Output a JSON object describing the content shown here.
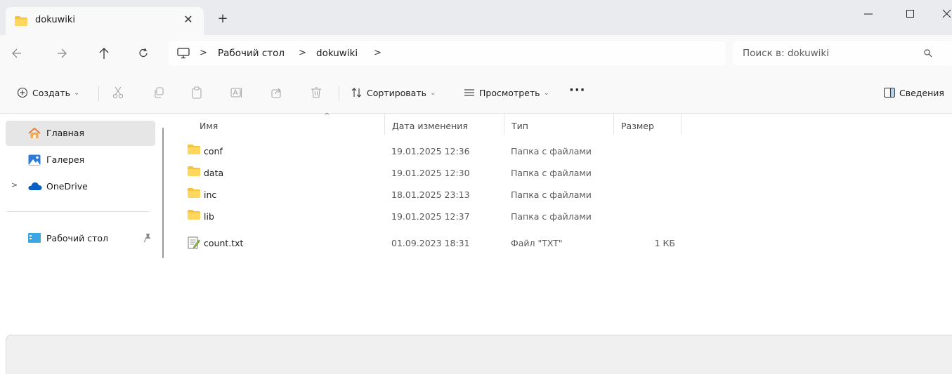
{
  "window": {
    "tab_title": "dokuwiki",
    "close_tab_glyph": "✕",
    "new_tab_glyph": "+",
    "minimize_glyph": "—",
    "maximize_glyph": "☐",
    "close_glyph": "✕"
  },
  "address": {
    "crumbs": [
      "Рабочий стол",
      "dokuwiki"
    ],
    "separator": ">",
    "search_placeholder": "Поиск в: dokuwiki"
  },
  "toolbar": {
    "new_label": "Создать",
    "sort_label": "Сортировать",
    "view_label": "Просмотреть",
    "more_label": "···",
    "details_label": "Сведения",
    "chevron": "⌄"
  },
  "sidebar": {
    "items": [
      {
        "label": "Главная",
        "icon": "home-icon",
        "active": true
      },
      {
        "label": "Галерея",
        "icon": "gallery-icon"
      },
      {
        "label": "OneDrive",
        "icon": "onedrive-icon",
        "expander": ">"
      },
      {
        "label": "Рабочий стол",
        "icon": "desktop-icon",
        "pinned": true
      }
    ]
  },
  "files": {
    "columns": [
      "Имя",
      "Дата изменения",
      "Тип",
      "Размер"
    ],
    "sort_indicator": "^",
    "rows": [
      {
        "name": "conf",
        "date": "19.01.2025 12:36",
        "type": "Папка с файлами",
        "size": "",
        "icon": "folder-icon"
      },
      {
        "name": "data",
        "date": "19.01.2025 12:30",
        "type": "Папка с файлами",
        "size": "",
        "icon": "folder-icon"
      },
      {
        "name": "inc",
        "date": "18.01.2025 23:13",
        "type": "Папка с файлами",
        "size": "",
        "icon": "folder-icon"
      },
      {
        "name": "lib",
        "date": "19.01.2025 12:37",
        "type": "Папка с файлами",
        "size": "",
        "icon": "folder-icon"
      },
      {
        "name": "count.txt",
        "date": "01.09.2023 18:31",
        "type": "Файл \"TXT\"",
        "size": "1 КБ",
        "icon": "text-file-icon"
      }
    ]
  },
  "colors": {
    "folder": "#f5c43c",
    "accent": "#0067c0",
    "selected_bg": "#e6e6e6"
  }
}
